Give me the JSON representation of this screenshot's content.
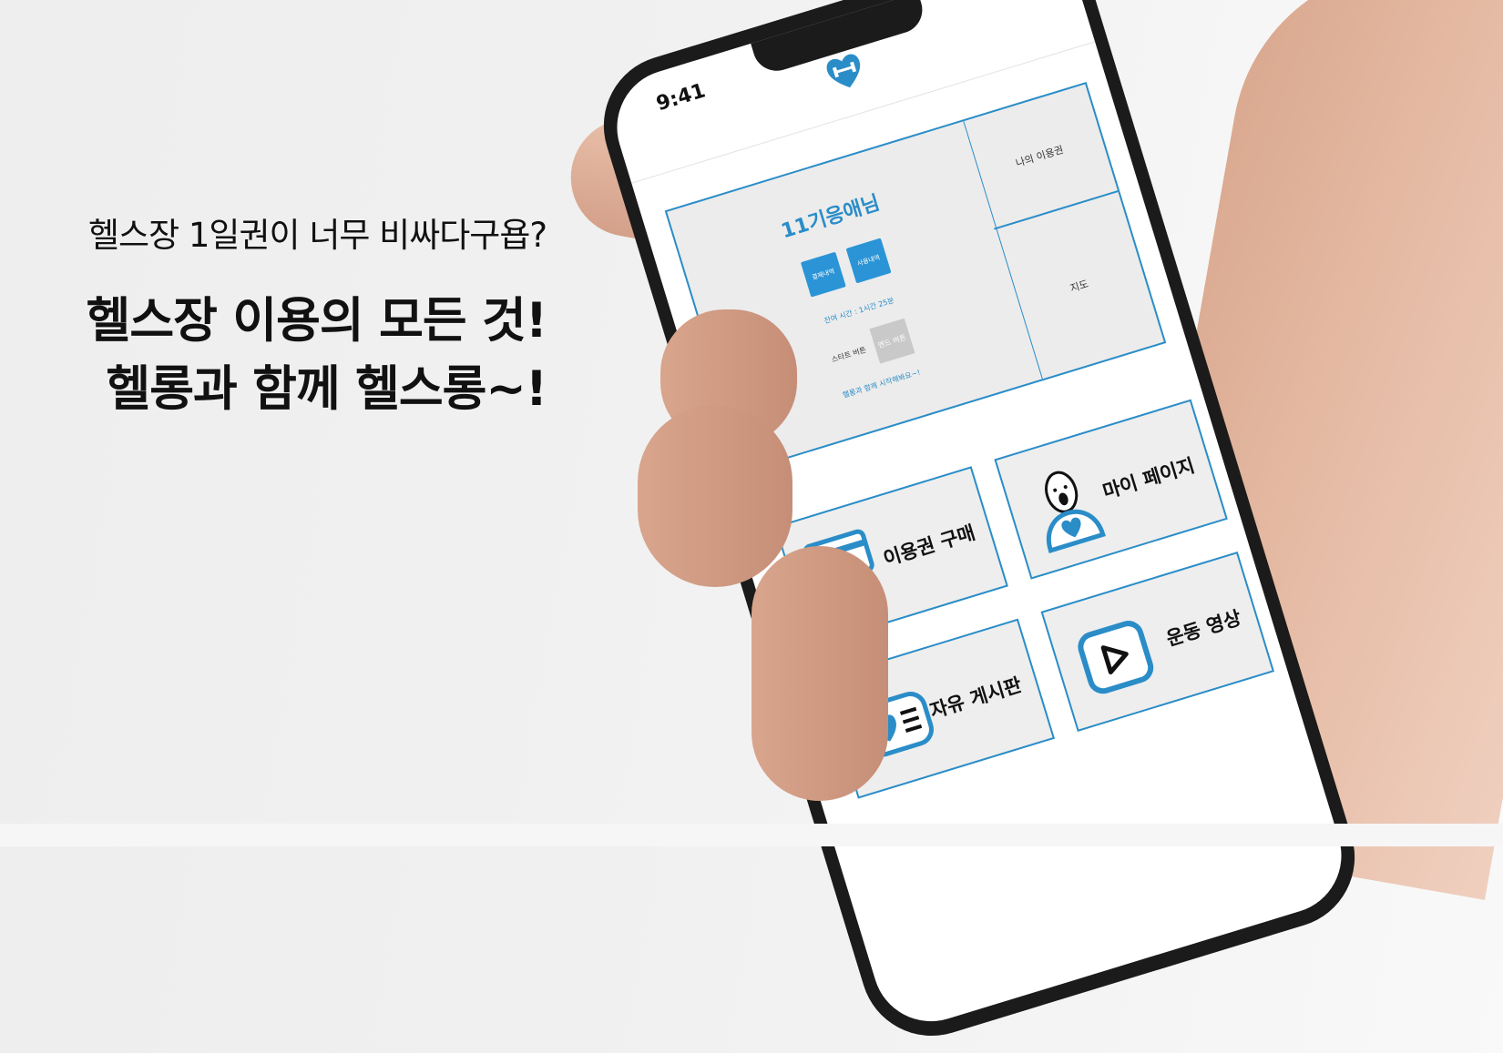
{
  "hero": {
    "subtitle": "헬스장 1일권이 너무 비싸다구욥?",
    "headline_line1": "헬스장 이용의 모든 것!",
    "headline_line2": "헬롱과 함께 헬스롱~!"
  },
  "phone": {
    "status_time": "9:41",
    "logo_icon": "heart-dumbbell-logo-icon"
  },
  "info_panel": {
    "user_name": "11기응애님",
    "buttons": [
      "결제내역",
      "사용내역"
    ],
    "remaining_time": "잔여 시간 : 1시간 25분",
    "start_label": "스타트 버튼",
    "end_button": "엔드 버튼",
    "start_message": "헬롱과 함께 시작해봐요~!",
    "my_ticket": "나의 이용권",
    "map": "지도"
  },
  "menu": {
    "buy": "이용권 구매",
    "mypage": "마이 페이지",
    "board": "자유 게시판",
    "video": "운동 영상"
  },
  "colors": {
    "accent": "#2a8dc8",
    "button_blue": "#2b94d6",
    "card_bg": "#eeeeee",
    "end_button_gray": "#c9c9c9"
  }
}
